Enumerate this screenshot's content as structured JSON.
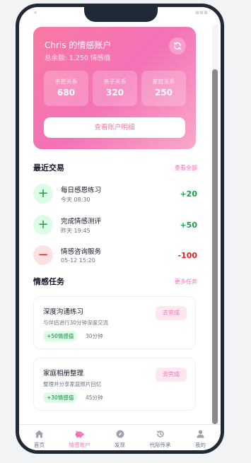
{
  "colors": {
    "accent": "#f472b6",
    "positive": "#16a34a",
    "negative": "#dc2626",
    "frame": "#1f2937"
  },
  "account": {
    "title": "Chris 的情感账户",
    "balance": "总余额: 1,250 情感值",
    "stats": [
      {
        "label": "亲密关系",
        "value": "680"
      },
      {
        "label": "亲子关系",
        "value": "320"
      },
      {
        "label": "家庭关系",
        "value": "250"
      }
    ],
    "detail_button": "查看账户明细",
    "refresh_icon": "refresh-icon"
  },
  "transactions": {
    "title": "最近交易",
    "view_all": "查看全部",
    "items": [
      {
        "name": "每日感恩练习",
        "time": "今天 08:30",
        "amount": "+20",
        "type": "plus"
      },
      {
        "name": "完成情感测评",
        "time": "昨天 19:45",
        "amount": "+50",
        "type": "plus"
      },
      {
        "name": "情感咨询服务",
        "time": "05-12 15:20",
        "amount": "-100",
        "type": "minus"
      }
    ]
  },
  "tasks": {
    "title": "情感任务",
    "more": "更多任务",
    "items": [
      {
        "name": "深度沟通练习",
        "desc": "与伴侣进行30分钟深度交流",
        "reward": "+50情感值",
        "duration": "30分钟",
        "button": "去完成"
      },
      {
        "name": "家庭相册整理",
        "desc": "整理并分享家庭照片回忆",
        "reward": "+30情感值",
        "duration": "45分钟",
        "button": "去完成"
      }
    ]
  },
  "tabbar": [
    {
      "label": "首页",
      "icon": "home-icon",
      "active": false
    },
    {
      "label": "情感账户",
      "icon": "piggy-bank-icon",
      "active": true
    },
    {
      "label": "发现",
      "icon": "compass-icon",
      "active": false
    },
    {
      "label": "代际传承",
      "icon": "history-icon",
      "active": false
    },
    {
      "label": "我的",
      "icon": "user-icon",
      "active": false
    }
  ]
}
